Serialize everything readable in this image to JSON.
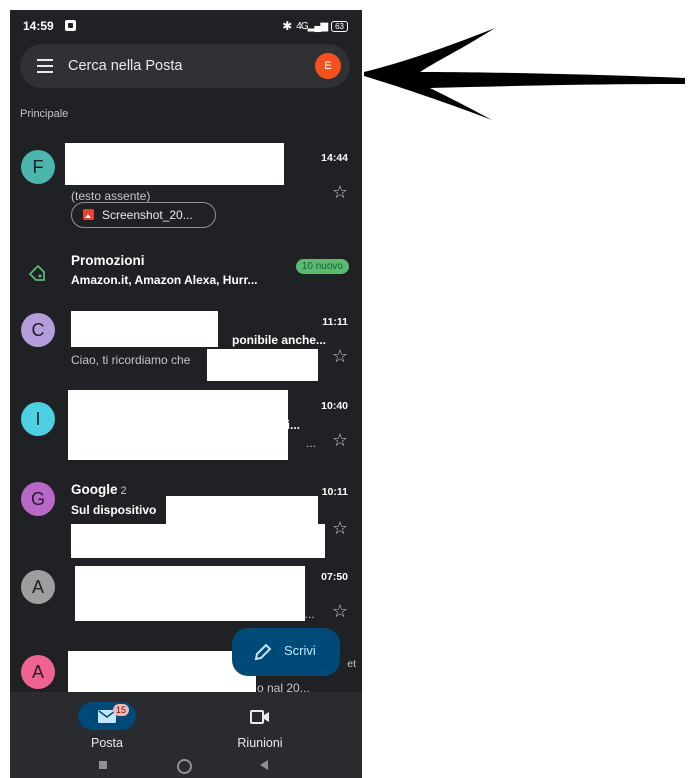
{
  "status": {
    "time": "14:59",
    "network": "4G",
    "battery": "63"
  },
  "search": {
    "placeholder": "Cerca nella Posta",
    "avatar_letter": "E"
  },
  "section_label": "Principale",
  "emails": [
    {
      "avatar": "F",
      "avatar_color": "#4db6ac",
      "time": "14:44",
      "preview": "(testo assente)",
      "attachment": "Screenshot_20..."
    },
    {
      "avatar": "C",
      "avatar_color": "#b39ddb",
      "time": "11:11",
      "subject_fragment": "ponibile anche...",
      "preview": "Ciao, ti ricordiamo che"
    },
    {
      "avatar": "I",
      "avatar_color": "#4dd0e1",
      "time": "10:40",
      "subject_fragment": "sti...",
      "preview_fragment": "..."
    },
    {
      "avatar": "G",
      "avatar_color": "#ba68c8",
      "sender": "Google",
      "count": "2",
      "time": "10:11",
      "subject": "Sul dispositivo"
    },
    {
      "avatar": "A",
      "avatar_color": "#9e9e9e",
      "time": "07:50",
      "preview_fragment": "e..."
    },
    {
      "avatar": "A",
      "avatar_color": "#f06292",
      "time_fragment": "et",
      "preview_fragment": "o nal 20..."
    }
  ],
  "promotions": {
    "title": "Promozioni",
    "senders": "Amazon.it, Amazon Alexa, Hurr...",
    "badge": "10 nuovo"
  },
  "fab": {
    "label": "Scrivi"
  },
  "bottom_nav": {
    "mail_label": "Posta",
    "mail_badge": "15",
    "meet_label": "Riunioni"
  },
  "colors": {
    "background": "#202124",
    "search_bar": "#303134",
    "accent": "#004a77",
    "avatar_e": "#f4511e",
    "badge_new": "#5bb974"
  }
}
